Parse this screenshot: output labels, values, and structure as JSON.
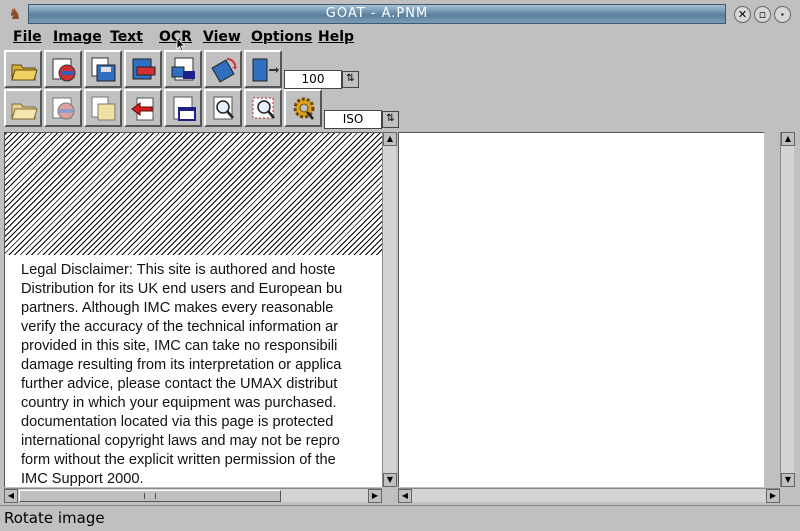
{
  "window": {
    "title": "GOAT - A.PNM"
  },
  "menu": [
    {
      "label": "File"
    },
    {
      "label": "Image"
    },
    {
      "label": "Text"
    },
    {
      "label": "OCR"
    },
    {
      "label": "View"
    },
    {
      "label": "Options"
    },
    {
      "label": "Help"
    }
  ],
  "toolbar": {
    "zoom_value": "100",
    "language_value": "ISO"
  },
  "document": {
    "lines": [
      "Legal Disclaimer: This site is authored and hoste",
      "Distribution for its UK end users and European bu",
      "partners. Although IMC makes every reasonable",
      "verify the accuracy of the technical information ar",
      "provided in this site, IMC can take no responsibili",
      "damage resulting from its interpretation or applica",
      "further advice, please contact the UMAX distribut",
      "country in which your equipment was purchased.",
      "documentation located via this page is protected",
      "international copyright laws and may not be repro",
      "form without the explicit written permission of the",
      "IMC Support 2000."
    ]
  },
  "status": {
    "text": "Rotate image"
  }
}
